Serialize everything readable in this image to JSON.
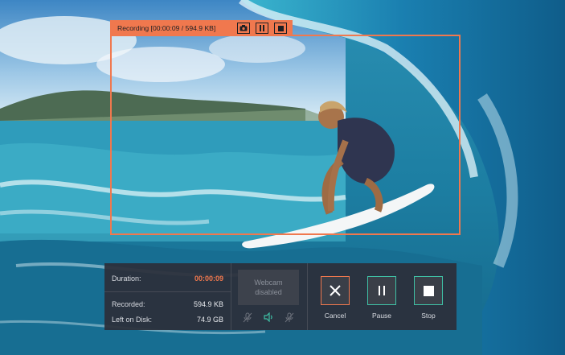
{
  "recording_bar": {
    "status_text": "Recording [00:00:09 / 594.9 KB]",
    "accent_color": "#f0784e",
    "buttons": [
      "camera-icon",
      "pause-icon",
      "stop-icon"
    ]
  },
  "stats": {
    "duration_label": "Duration:",
    "duration_value": "00:00:09",
    "recorded_label": "Recorded:",
    "recorded_value": "594.9 KB",
    "disk_label": "Left on Disk:",
    "disk_value": "74.9 GB"
  },
  "webcam": {
    "line1": "Webcam",
    "line2": "disabled",
    "icons": [
      "microphone-muted-icon",
      "speaker-icon",
      "webcam-muted-icon"
    ]
  },
  "actions": {
    "cancel_label": "Cancel",
    "pause_label": "Pause",
    "stop_label": "Stop",
    "cancel_color": "#f0784e",
    "pause_color": "#3fc1a6",
    "stop_color": "#3fc1a6"
  }
}
